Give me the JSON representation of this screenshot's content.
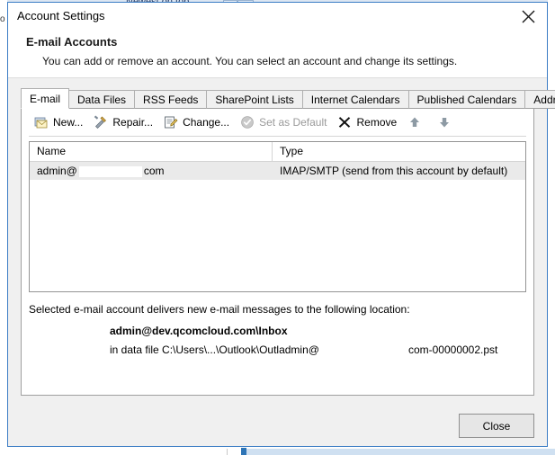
{
  "background": {
    "newest_on_top_label": "Newest on top"
  },
  "dialog": {
    "title": "Account Settings",
    "close_icon": "close-icon",
    "header": {
      "title": "E-mail Accounts",
      "subtitle": "You can add or remove an account. You can select an account and change its settings."
    },
    "tabs": [
      {
        "label": "E-mail",
        "selected": true
      },
      {
        "label": "Data Files",
        "selected": false
      },
      {
        "label": "RSS Feeds",
        "selected": false
      },
      {
        "label": "SharePoint Lists",
        "selected": false
      },
      {
        "label": "Internet Calendars",
        "selected": false
      },
      {
        "label": "Published Calendars",
        "selected": false
      },
      {
        "label": "Address Books",
        "selected": false
      }
    ],
    "toolbar": [
      {
        "label": "New...",
        "icon": "new-mail-icon",
        "enabled": true
      },
      {
        "label": "Repair...",
        "icon": "repair-tools-icon",
        "enabled": true
      },
      {
        "label": "Change...",
        "icon": "change-properties-icon",
        "enabled": true
      },
      {
        "label": "Set as Default",
        "icon": "check-circle-icon",
        "enabled": false
      },
      {
        "label": "Remove",
        "icon": "x-mark-icon",
        "enabled": true
      },
      {
        "label": "",
        "icon": "arrow-up-icon",
        "enabled": true
      },
      {
        "label": "",
        "icon": "arrow-down-icon",
        "enabled": true
      }
    ],
    "accounts_table": {
      "columns": [
        "Name",
        "Type"
      ],
      "rows": [
        {
          "name_prefix": "admin@",
          "name_redacted": true,
          "name_suffix": "com",
          "type": "IMAP/SMTP (send from this account by default)",
          "selected": true
        }
      ]
    },
    "delivery": {
      "caption": "Selected e-mail account delivers new e-mail messages to the following location:",
      "location": "admin@dev.qcomcloud.com\\Inbox",
      "data_file_prefix": "in data file C:\\Users\\...\\Outlook\\Outladmin@",
      "data_file_suffix": "com-00000002.pst"
    },
    "footer": {
      "close_label": "Close"
    },
    "colors": {
      "border_blue": "#3a7cc4",
      "dialog_bg": "#f0f0f0",
      "panel_bg": "#ffffff",
      "selected_row": "#eaeaea",
      "disabled_text": "#9a9a9a"
    }
  }
}
